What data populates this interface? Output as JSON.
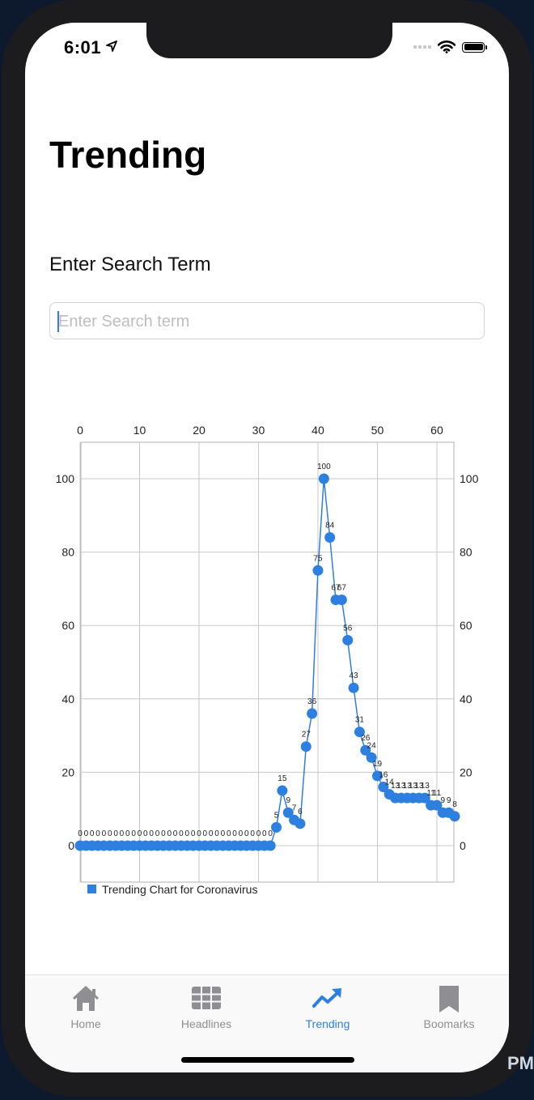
{
  "status_bar": {
    "time": "6:01"
  },
  "header": {
    "title": "Trending"
  },
  "search": {
    "label": "Enter Search Term",
    "placeholder": "Enter Search term",
    "value": ""
  },
  "chart_data": {
    "type": "line",
    "x": [
      0,
      1,
      2,
      3,
      4,
      5,
      6,
      7,
      8,
      9,
      10,
      11,
      12,
      13,
      14,
      15,
      16,
      17,
      18,
      19,
      20,
      21,
      22,
      23,
      24,
      25,
      26,
      27,
      28,
      29,
      30,
      31,
      32,
      33,
      34,
      35,
      36,
      37,
      38,
      39,
      40,
      41,
      42,
      43,
      44,
      45,
      46,
      47,
      48,
      49,
      50,
      51,
      52,
      53,
      54,
      55,
      56,
      57,
      58,
      59,
      60,
      61,
      62,
      63
    ],
    "series": [
      {
        "name": "Trending Chart for Coronavirus",
        "values": [
          0,
          0,
          0,
          0,
          0,
          0,
          0,
          0,
          0,
          0,
          0,
          0,
          0,
          0,
          0,
          0,
          0,
          0,
          0,
          0,
          0,
          0,
          0,
          0,
          0,
          0,
          0,
          0,
          0,
          0,
          0,
          0,
          0,
          5,
          15,
          9,
          7,
          6,
          27,
          36,
          75,
          100,
          84,
          67,
          67,
          56,
          43,
          31,
          26,
          24,
          19,
          16,
          14,
          13,
          13,
          13,
          13,
          13,
          13,
          11,
          11,
          9,
          9,
          8
        ],
        "color": "#2d7fe0"
      }
    ],
    "x_ticks": [
      0,
      10,
      20,
      30,
      40,
      50,
      60
    ],
    "y_ticks": [
      0,
      20,
      40,
      60,
      80,
      100
    ],
    "xlim": [
      0,
      63
    ],
    "ylim": [
      -10,
      100
    ],
    "grid": true,
    "legend": "bottom-left",
    "x_axis_position": "top",
    "y_axis_position": "both"
  },
  "tabbar": {
    "tabs": [
      {
        "label": "Home",
        "icon": "house-icon",
        "active": false
      },
      {
        "label": "Headlines",
        "icon": "grid-icon",
        "active": false
      },
      {
        "label": "Trending",
        "icon": "trending-icon",
        "active": true
      },
      {
        "label": "Boomarks",
        "icon": "bookmark-icon",
        "active": false
      }
    ],
    "active_color": "#2d7fe0",
    "inactive_color": "#8e8e93"
  }
}
